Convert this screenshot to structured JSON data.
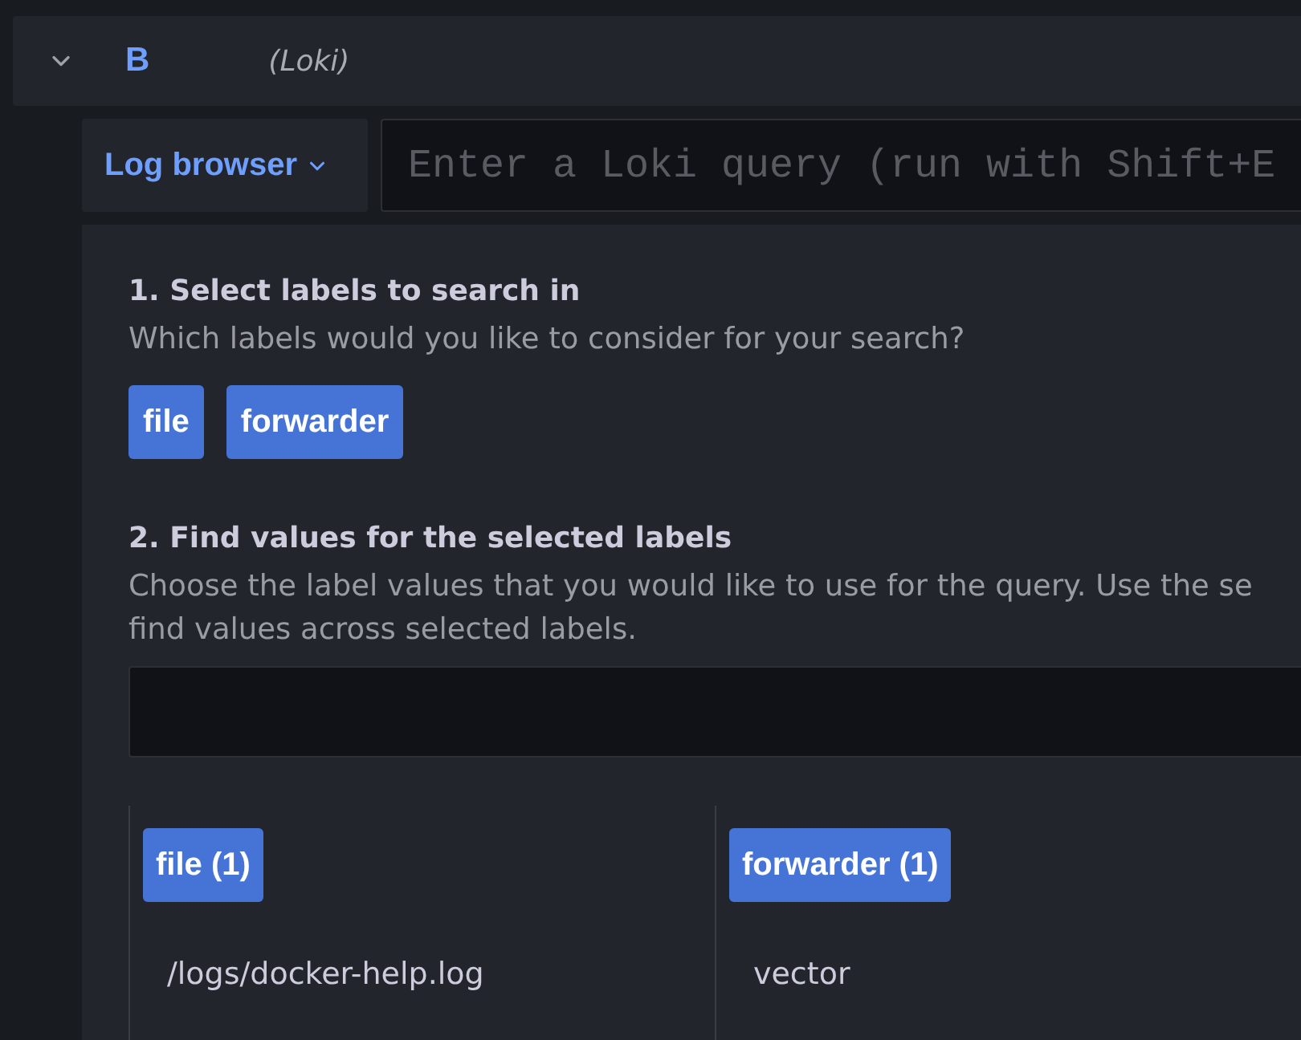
{
  "query_row": {
    "expanded": true,
    "ref_id": "B",
    "datasource": "(Loki)"
  },
  "query_editor": {
    "mode_button": {
      "label": "Log browser"
    },
    "query_field": {
      "placeholder": "Enter a Loki query (run with Shift+E"
    }
  },
  "log_browser": {
    "step_1": {
      "title": "1. Select labels to search in",
      "description": "Which labels would you like to consider for your search?",
      "labels": [
        {
          "label": "file",
          "selected": true
        },
        {
          "label": "forwarder",
          "selected": true
        }
      ]
    },
    "step_2": {
      "title": "2. Find values for the selected labels",
      "description": "Choose the label values that you would like to use for the query. Use the se\nfind values across selected labels.",
      "value_lists": [
        {
          "title": "file (1)",
          "values": [
            {
              "value": "/logs/docker-help.log",
              "selected": false
            }
          ]
        },
        {
          "title": "forwarder (1)",
          "values": [
            {
              "value": "vector",
              "selected": false
            }
          ]
        }
      ]
    }
  }
}
